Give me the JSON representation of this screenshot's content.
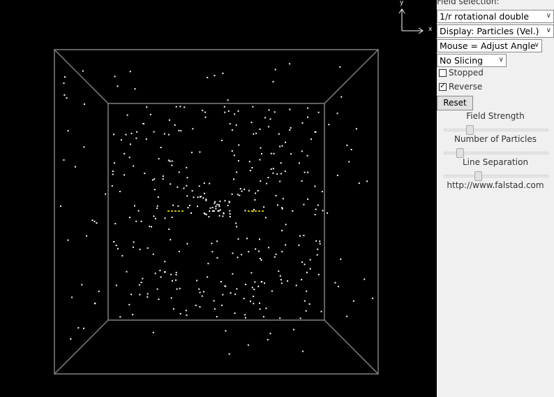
{
  "panel": {
    "field_label": "Field selection:",
    "field_select": "1/r rotational double",
    "display_select": "Display: Particles (Vel.)",
    "mouse_select": "Mouse = Adjust Angle",
    "slicing_select": "No Slicing",
    "stopped": {
      "label": "Stopped",
      "checked": false
    },
    "reverse": {
      "label": "Reverse",
      "checked": true
    },
    "reset_label": "Reset",
    "field_strength": {
      "label": "Field Strength",
      "value": 0.22
    },
    "num_particles": {
      "label": "Number of Particles",
      "value": 0.12
    },
    "line_separation": {
      "label": "Line Separation",
      "value": 0.31
    },
    "url": "http://www.falstad.com"
  },
  "axes": {
    "y": "y",
    "x": "x"
  },
  "colors": {
    "background": "#000000",
    "box": "#808080",
    "particle": "#ffffff",
    "charge": "#ffff00",
    "panel": "#f0f0f0"
  }
}
